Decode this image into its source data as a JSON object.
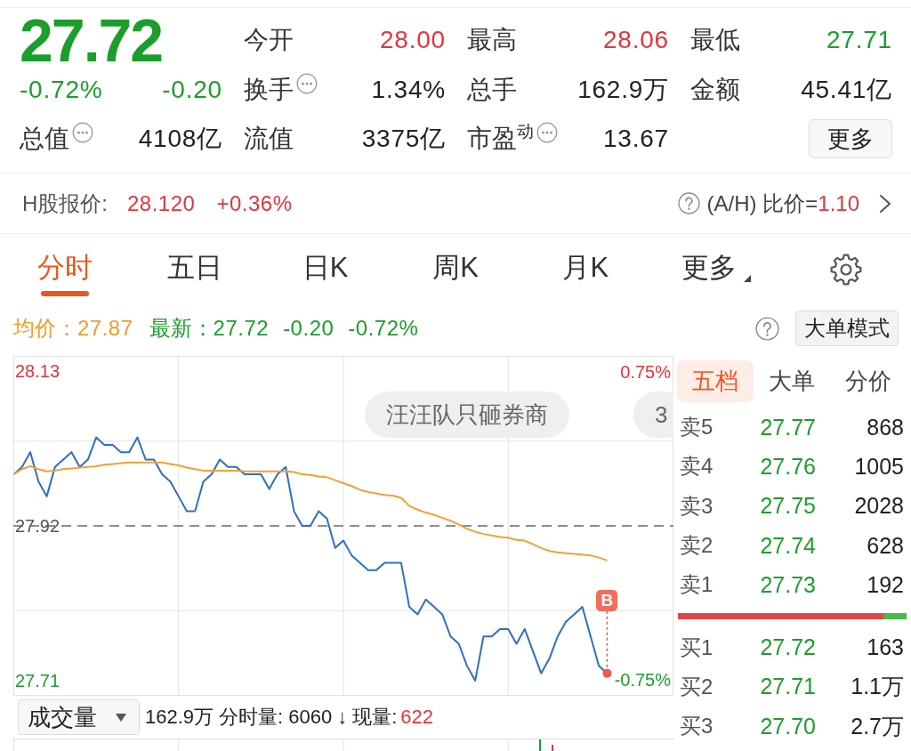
{
  "quote": {
    "price": "27.72",
    "change_pct": "-0.72%",
    "change": "-0.20",
    "market_cap": {
      "label": "总值",
      "value": "4108亿",
      "info": true,
      "color": "#222222"
    }
  },
  "stats": [
    {
      "label": "今开",
      "value": "28.00",
      "color": "#e5343b",
      "info": false
    },
    {
      "label": "最高",
      "value": "28.06",
      "color": "#e5343b",
      "info": false
    },
    {
      "label": "最低",
      "value": "27.71",
      "color": "#1b9e2b",
      "info": false
    },
    {
      "label": "换手",
      "value": "1.34%",
      "color": "#222222",
      "info": true
    },
    {
      "label": "总手",
      "value": "162.9万",
      "color": "#222222",
      "info": false
    },
    {
      "label": "金额",
      "value": "45.41亿",
      "color": "#222222",
      "info": false
    },
    {
      "label": "流值",
      "value": "3375亿",
      "color": "#222222",
      "info": false
    },
    {
      "label": "市盈$^{动}$",
      "value": "13.67",
      "color": "#222222",
      "info": true
    }
  ],
  "more_button": "更多",
  "h_share": {
    "label": "H股报价:",
    "price": "28.120",
    "change": "+0.36%",
    "ratio_label": "(A/H) 比价=",
    "ratio": "1.10"
  },
  "tabs": [
    {
      "label": "分时",
      "selected": true,
      "dropdown": false
    },
    {
      "label": "五日",
      "selected": false,
      "dropdown": false
    },
    {
      "label": "日K",
      "selected": false,
      "dropdown": false
    },
    {
      "label": "周K",
      "selected": false,
      "dropdown": false
    },
    {
      "label": "月K",
      "selected": false,
      "dropdown": false
    },
    {
      "label": "更多",
      "selected": false,
      "dropdown": true
    }
  ],
  "legend": {
    "avg_label": "均价：",
    "avg": "27.87",
    "last_label": "最新：",
    "last": "27.72",
    "change": "-0.20",
    "change_pct": "-0.72%",
    "mode_button": "大单模式"
  },
  "chart": {
    "comments": [
      {
        "text": "汪汪队只砸券商"
      },
      {
        "text": "3"
      }
    ],
    "chart_data": {
      "type": "line",
      "categories": [
        null,
        null,
        null,
        null,
        null,
        null,
        null,
        null,
        null,
        null,
        null,
        null,
        null,
        null,
        null,
        null,
        null,
        null,
        null,
        null,
        null,
        null,
        null,
        null,
        null,
        null,
        null,
        null,
        null,
        null,
        null,
        null,
        null,
        null,
        null,
        null,
        null,
        null,
        null,
        null,
        null,
        null,
        null,
        null,
        null,
        null,
        null,
        null,
        null,
        null,
        null,
        null,
        null,
        null,
        null,
        null,
        null,
        null,
        null,
        null,
        null,
        null,
        null,
        null,
        null,
        null,
        null,
        null,
        null,
        null,
        null,
        null,
        null,
        null,
        null,
        null,
        null,
        null,
        null,
        null,
        null
      ],
      "ylim": [
        27.69,
        28.15
      ],
      "yticks": [
        {
          "value": 28.13,
          "label": "28.13"
        },
        {
          "value": 27.71,
          "label": "27.71"
        }
      ],
      "y2lim": [
        -0.824,
        0.824
      ],
      "y2ticks": [
        {
          "value": 0.75,
          "label": "0.75%"
        },
        {
          "value": -0.75,
          "label": "-0.75%"
        }
      ],
      "grid": true,
      "series": [
        {
          "color": "#2f6ec2",
          "values": [
            27.99,
            28.0,
            28.02,
            27.98,
            27.96,
            28.0,
            28.01,
            28.02,
            28.0,
            28.01,
            28.04,
            28.03,
            28.03,
            28.02,
            28.02,
            28.04,
            28.01,
            28.01,
            27.99,
            27.98,
            27.96,
            27.94,
            27.94,
            27.98,
            27.99,
            28.01,
            28.0,
            28.0,
            27.99,
            27.99,
            27.99,
            27.97,
            27.99,
            28.0,
            27.94,
            27.92,
            27.92,
            27.94,
            27.93,
            27.89,
            27.9,
            27.88,
            27.87,
            27.86,
            27.86,
            27.87,
            27.87,
            27.87,
            27.81,
            27.8,
            27.82,
            27.81,
            27.8,
            27.77,
            27.76,
            27.73,
            27.71,
            27.77,
            27.77,
            27.78,
            27.78,
            27.76,
            27.78,
            27.75,
            27.72,
            27.74,
            27.77,
            27.79,
            27.8,
            27.81,
            27.77,
            27.73,
            27.72,
            null,
            null,
            null,
            null,
            null,
            null,
            null,
            null
          ]
        },
        {
          "color": "#f2a035",
          "values": [
            27.99,
            27.997,
            28.001,
            27.997,
            27.994,
            27.995,
            27.997,
            27.998,
            27.999,
            28.0,
            28.001,
            28.003,
            28.004,
            28.005,
            28.006,
            28.006,
            28.006,
            28.006,
            28.006,
            28.004,
            28.002,
            27.999,
            27.997,
            27.995,
            27.995,
            27.995,
            27.995,
            27.995,
            27.994,
            27.994,
            27.994,
            27.994,
            27.994,
            27.994,
            27.993,
            27.99,
            27.989,
            27.987,
            27.986,
            27.982,
            27.978,
            27.974,
            27.969,
            27.966,
            27.964,
            27.962,
            27.961,
            27.958,
            27.947,
            27.942,
            27.938,
            27.935,
            27.931,
            27.927,
            27.922,
            27.916,
            27.912,
            27.909,
            27.907,
            27.905,
            27.904,
            27.901,
            27.9,
            27.895,
            27.89,
            27.886,
            27.884,
            27.883,
            27.882,
            27.881,
            27.88,
            27.877,
            27.873,
            null,
            null,
            null,
            null,
            null,
            null,
            null,
            null
          ]
        }
      ],
      "ref_lines": [
        {
          "axis": "y",
          "value": 27.92,
          "label": "27.92"
        }
      ],
      "annotations": [
        {
          "text": "B"
        }
      ]
    }
  },
  "volume": {
    "selector": "成交量",
    "total": "162.9万",
    "minute": "分时量: 6060",
    "arrow": "↓",
    "current_label": "现量:",
    "current": "622"
  },
  "order_book": {
    "tabs": [
      {
        "label": "五档",
        "selected": true
      },
      {
        "label": "大单",
        "selected": false
      },
      {
        "label": "分价",
        "selected": false
      }
    ],
    "asks": [
      {
        "label": "卖5",
        "price": "27.77",
        "volume": "868"
      },
      {
        "label": "卖4",
        "price": "27.76",
        "volume": "1005"
      },
      {
        "label": "卖3",
        "price": "27.75",
        "volume": "2028"
      },
      {
        "label": "卖2",
        "price": "27.74",
        "volume": "628"
      },
      {
        "label": "卖1",
        "price": "27.73",
        "volume": "192"
      }
    ],
    "ratio_bar": {
      "level": 0.9
    },
    "bids": [
      {
        "label": "买1",
        "price": "27.72",
        "volume": "163"
      },
      {
        "label": "买2",
        "price": "27.71",
        "volume": "1.1万"
      },
      {
        "label": "买3",
        "price": "27.70",
        "volume": "2.7万"
      }
    ]
  }
}
